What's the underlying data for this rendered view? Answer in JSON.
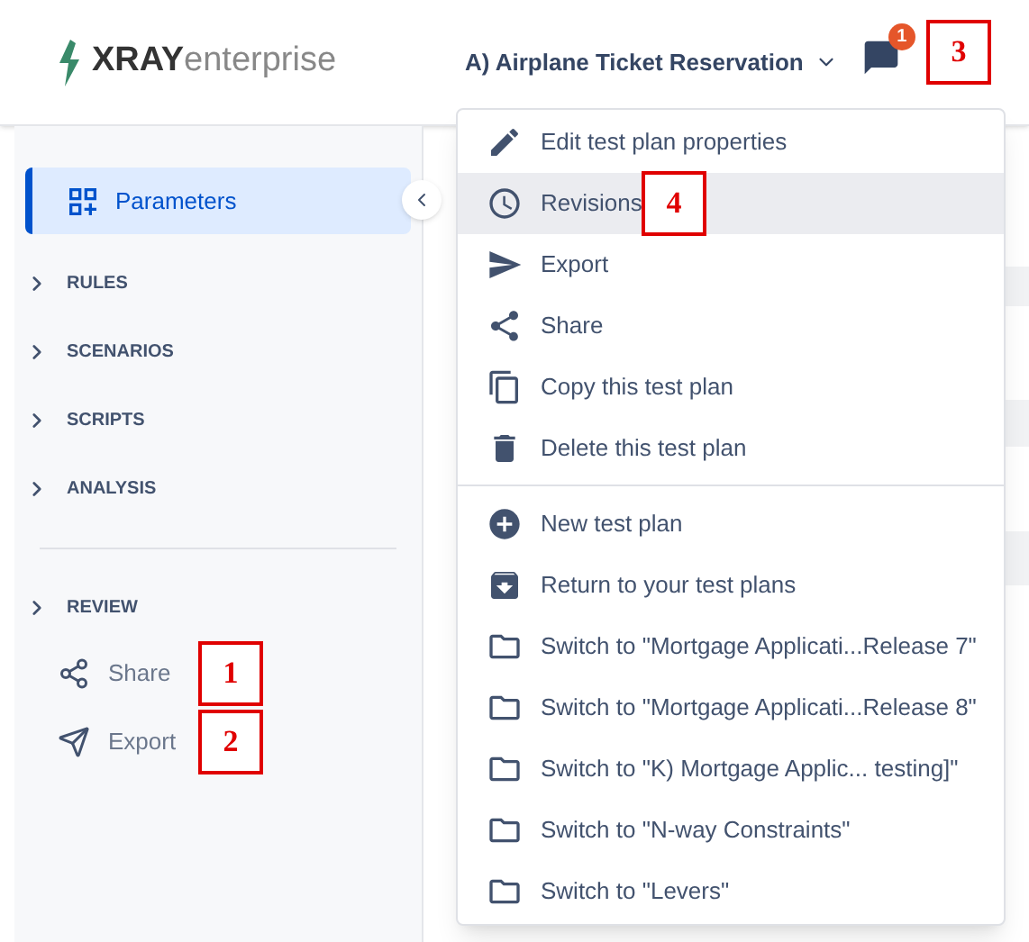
{
  "header": {
    "logo": {
      "bold": "XRAY",
      "light": "enterprise"
    },
    "plan_title": "A) Airplane Ticket Reservation",
    "notifications": {
      "count": "1",
      "callout": "3"
    }
  },
  "sidebar": {
    "items": [
      {
        "label": "Parameters",
        "selected": true
      }
    ],
    "sections": [
      {
        "label": "RULES"
      },
      {
        "label": "SCENARIOS"
      },
      {
        "label": "SCRIPTS"
      },
      {
        "label": "ANALYSIS"
      }
    ],
    "review": {
      "label": "REVIEW",
      "children": [
        {
          "label": "Share",
          "kind": "share",
          "callout": "1"
        },
        {
          "label": "Export",
          "kind": "export",
          "callout": "2"
        }
      ]
    }
  },
  "menu": {
    "groups": [
      [
        {
          "label": "Edit test plan properties",
          "kind": "edit",
          "selected": false
        },
        {
          "label": "Revisions",
          "kind": "history",
          "selected": true,
          "callout": "4"
        },
        {
          "label": "Export",
          "kind": "export",
          "selected": false
        },
        {
          "label": "Share",
          "kind": "share",
          "selected": false
        },
        {
          "label": "Copy this test plan",
          "kind": "copy",
          "selected": false
        },
        {
          "label": "Delete this test plan",
          "kind": "delete",
          "selected": false
        }
      ],
      [
        {
          "label": "New test plan",
          "kind": "new",
          "selected": false
        },
        {
          "label": "Return to your test plans",
          "kind": "archive",
          "selected": false
        },
        {
          "label": "Switch to \"Mortgage Applicati...Release 7\"",
          "kind": "folder",
          "selected": false
        },
        {
          "label": "Switch to \"Mortgage Applicati...Release 8\"",
          "kind": "folder",
          "selected": false
        },
        {
          "label": "Switch to \"K) Mortgage Applic... testing]\"",
          "kind": "folder",
          "selected": false
        },
        {
          "label": "Switch to \"N-way Constraints\"",
          "kind": "folder",
          "selected": false
        },
        {
          "label": "Switch to \"Levers\"",
          "kind": "folder",
          "selected": false
        }
      ]
    ]
  }
}
